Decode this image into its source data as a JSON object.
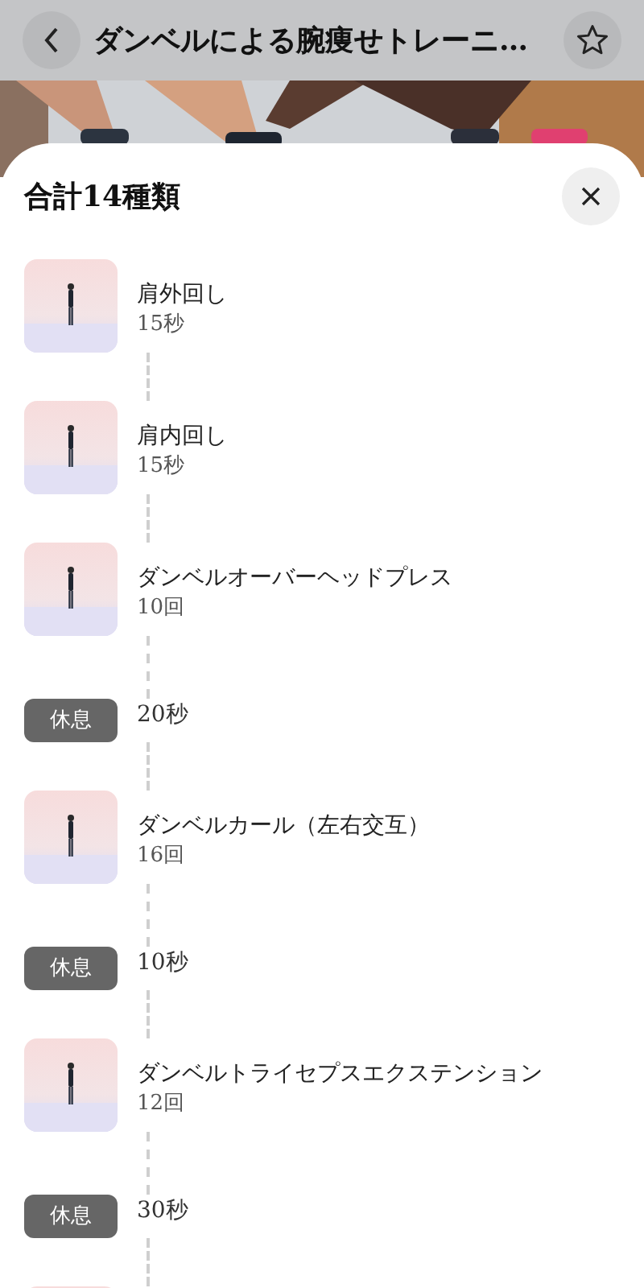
{
  "header": {
    "title": "ダンベルによる腕痩せトレーニ…"
  },
  "sheet": {
    "title": "合計14種類"
  },
  "items": [
    {
      "kind": "exercise",
      "name": "肩外回し",
      "amount": "15秒"
    },
    {
      "kind": "exercise",
      "name": "肩内回し",
      "amount": "15秒"
    },
    {
      "kind": "exercise",
      "name": "ダンベルオーバーヘッドプレス",
      "amount": "10回"
    },
    {
      "kind": "rest",
      "label": "休息",
      "amount": "20秒"
    },
    {
      "kind": "exercise",
      "name": "ダンベルカール（左右交互）",
      "amount": "16回"
    },
    {
      "kind": "rest",
      "label": "休息",
      "amount": "10秒"
    },
    {
      "kind": "exercise",
      "name": "ダンベルトライセプスエクステンション",
      "amount": "12回"
    },
    {
      "kind": "rest",
      "label": "休息",
      "amount": "30秒"
    },
    {
      "kind": "exercise"
    }
  ]
}
